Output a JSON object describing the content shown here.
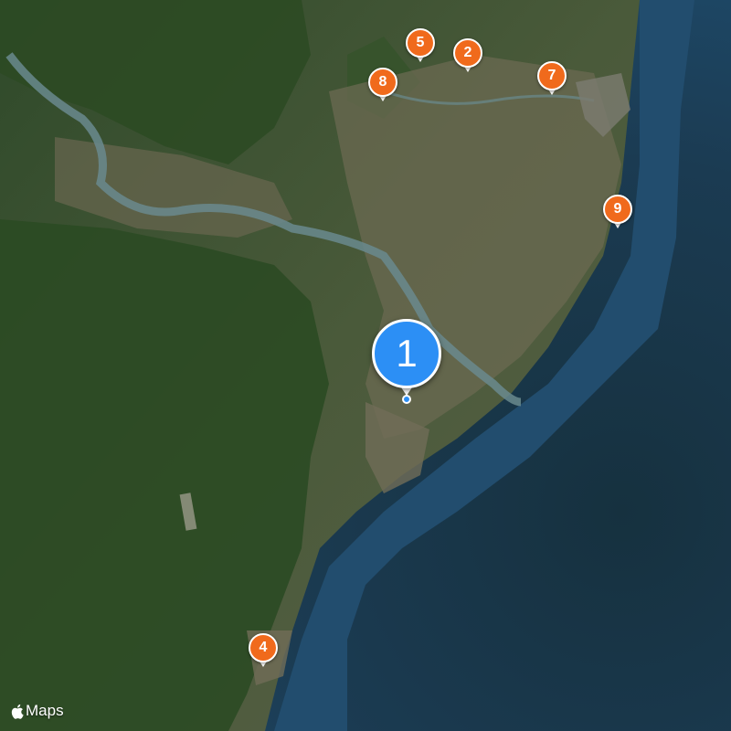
{
  "map": {
    "type": "satellite",
    "attribution": "Maps"
  },
  "markers": [
    {
      "label": "1",
      "kind": "primary",
      "color": "#2c8ff5"
    },
    {
      "label": "2",
      "kind": "poi",
      "color": "#f06a1c"
    },
    {
      "label": "4",
      "kind": "poi",
      "color": "#f06a1c"
    },
    {
      "label": "5",
      "kind": "poi",
      "color": "#f06a1c"
    },
    {
      "label": "7",
      "kind": "poi",
      "color": "#f06a1c"
    },
    {
      "label": "8",
      "kind": "poi",
      "color": "#f06a1c"
    },
    {
      "label": "9",
      "kind": "poi",
      "color": "#f06a1c"
    }
  ],
  "icons": {
    "brand": "apple-icon"
  }
}
